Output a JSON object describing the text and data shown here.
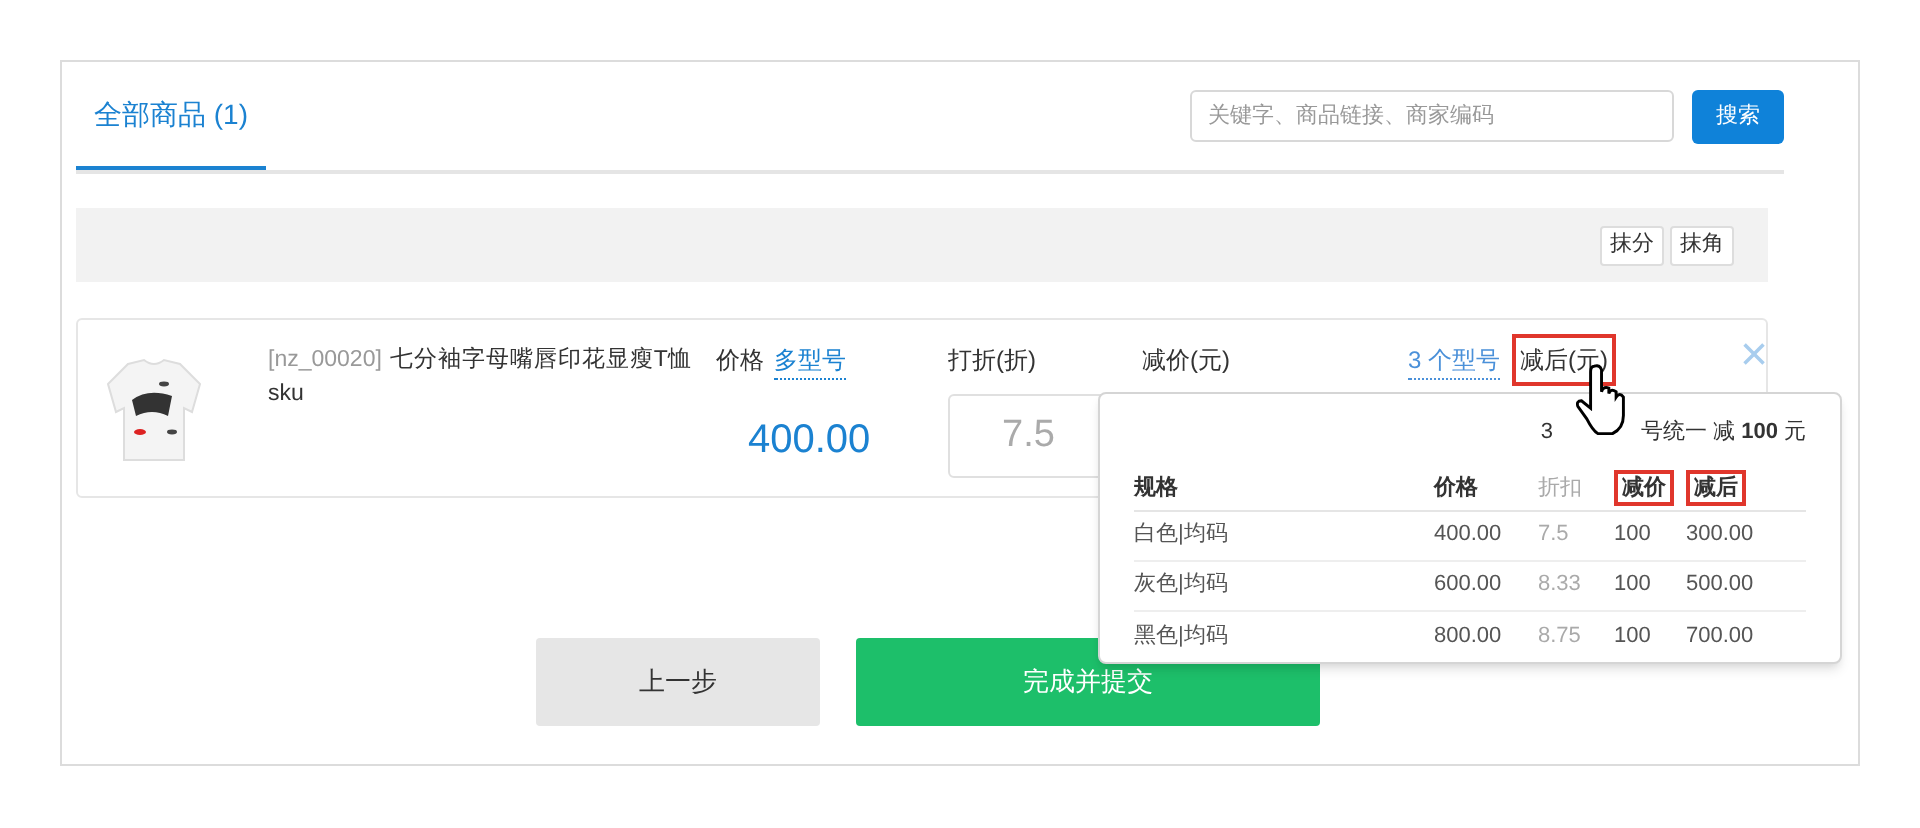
{
  "tabs": [
    {
      "label": "全部商品 (1)",
      "selected": true
    }
  ],
  "search": {
    "placeholder": "关键字、商品链接、商家编码",
    "button": "搜索"
  },
  "toolbar_buttons": [
    "抹分",
    "抹角"
  ],
  "product": {
    "code": "[nz_00020]",
    "name": "七分袖字母嘴唇印花显瘦T恤sku",
    "price_label": "价格",
    "price_link": "多型号",
    "price": "400.00",
    "discount_label": "打折(折)",
    "discount_value": "7.5",
    "reduce_label": "减价(元)",
    "variants_link": "3 个型号",
    "after_label": "减后(元)",
    "after_highlighted": true,
    "remove": "×"
  },
  "popover": {
    "summary_start": "3",
    "summary_end": "号统一 减 **100** 元",
    "columns": [
      {
        "label": "规格",
        "highlighted": false,
        "muted": false
      },
      {
        "label": "价格",
        "highlighted": false,
        "muted": false
      },
      {
        "label": "折扣",
        "highlighted": false,
        "muted": true
      },
      {
        "label": "减价",
        "highlighted": true,
        "muted": false
      },
      {
        "label": "减后",
        "highlighted": true,
        "muted": false
      }
    ],
    "rows": [
      [
        "白色|均码",
        "400.00",
        "7.5",
        "100",
        "300.00"
      ],
      [
        "灰色|均码",
        "600.00",
        "8.33",
        "100",
        "500.00"
      ],
      [
        "黑色|均码",
        "800.00",
        "8.75",
        "100",
        "700.00"
      ]
    ]
  },
  "buttons": [
    {
      "label": "上一步",
      "kind": "secondary"
    },
    {
      "label": "完成并提交",
      "kind": "primary"
    }
  ]
}
